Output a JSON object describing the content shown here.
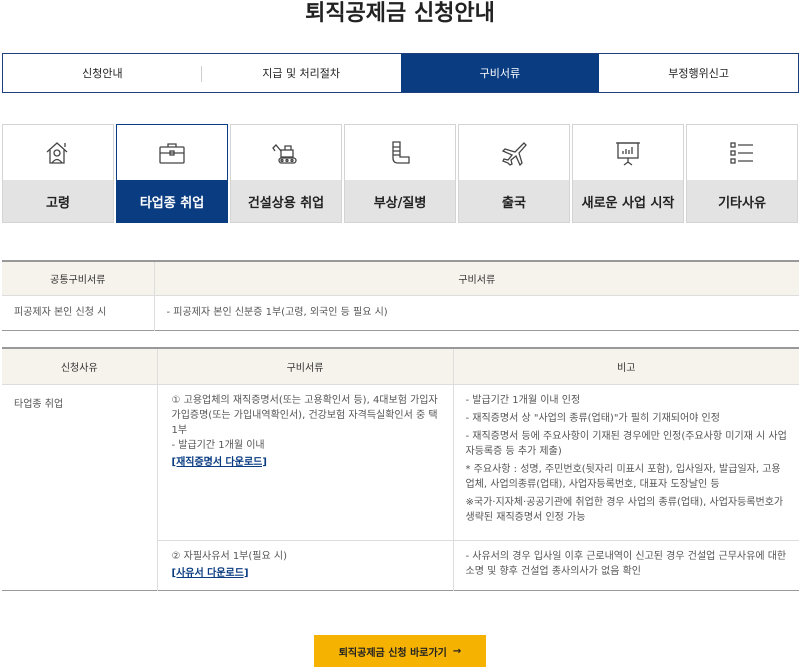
{
  "title": "퇴직공제금 신청안내",
  "main_tabs": [
    {
      "label": "신청안내"
    },
    {
      "label": "지급 및 처리절차"
    },
    {
      "label": "구비서류"
    },
    {
      "label": "부정행위신고"
    }
  ],
  "categories": [
    {
      "label": "고령",
      "icon": "elderly-icon"
    },
    {
      "label": "타업종 취업",
      "icon": "briefcase-icon"
    },
    {
      "label": "건설상용 취업",
      "icon": "excavator-icon"
    },
    {
      "label": "부상/질병",
      "icon": "cast-icon"
    },
    {
      "label": "출국",
      "icon": "airplane-icon"
    },
    {
      "label": "새로운 사업 시작",
      "icon": "presentation-icon"
    },
    {
      "label": "기타사유",
      "icon": "list-icon"
    }
  ],
  "common_table": {
    "headers": [
      "공통구비서류",
      "구비서류"
    ],
    "rows": [
      [
        "피공제자 본인 신청 시",
        "- 피공제자 본인 신분증 1부(고령, 외국인 등 필요 시)"
      ]
    ]
  },
  "detail_table": {
    "headers": [
      "신청사유",
      "구비서류",
      "비고"
    ],
    "reason": "타업종 취업",
    "row1": {
      "docs": "① 고용업체의 재직증명서(또는 고용확인서 등), 4대보험 가입자 가입증명(또는 가입내역확인서), 건강보험 자격득실확인서 중 택 1부",
      "docs_sub": "- 발급기간 1개월 이내",
      "download": "[재직증명서 다운로드]",
      "notes": [
        "- 발급기간 1개월 이내 인정",
        "- 재직증명서 상 \"사업의 종류(업태)\"가 필히 기재되어야 인정",
        "- 재직증명서 등에 주요사항이 기재된 경우에만 인정(주요사항 미기재 시 사업자등록증 등 추가 제출)",
        "* 주요사항 : 성명, 주민번호(뒷자리 미표시 포함), 입사일자, 발급일자, 고용업체, 사업의종류(업태), 사업자등록번호, 대표자 도장날인 등",
        "※국가·지자체·공공기관에 취업한 경우 사업의 종류(업태), 사업자등록번호가 생략된 재직증명서 인정 가능"
      ]
    },
    "row2": {
      "docs": "② 자필사유서 1부(필요 시)",
      "download": "[사유서 다운로드]",
      "notes": [
        "- 사유서의 경우 입사일 이후 근로내역이 신고된 경우 건설업 근무사유에 대한 소명 및 향후 건설업 종사의사가 없음 확인"
      ]
    }
  },
  "cta": {
    "label": "퇴직공제금 신청 바로가기",
    "arrow": "→"
  },
  "colors": {
    "primary": "#0a3c82",
    "accent": "#f5b200"
  }
}
